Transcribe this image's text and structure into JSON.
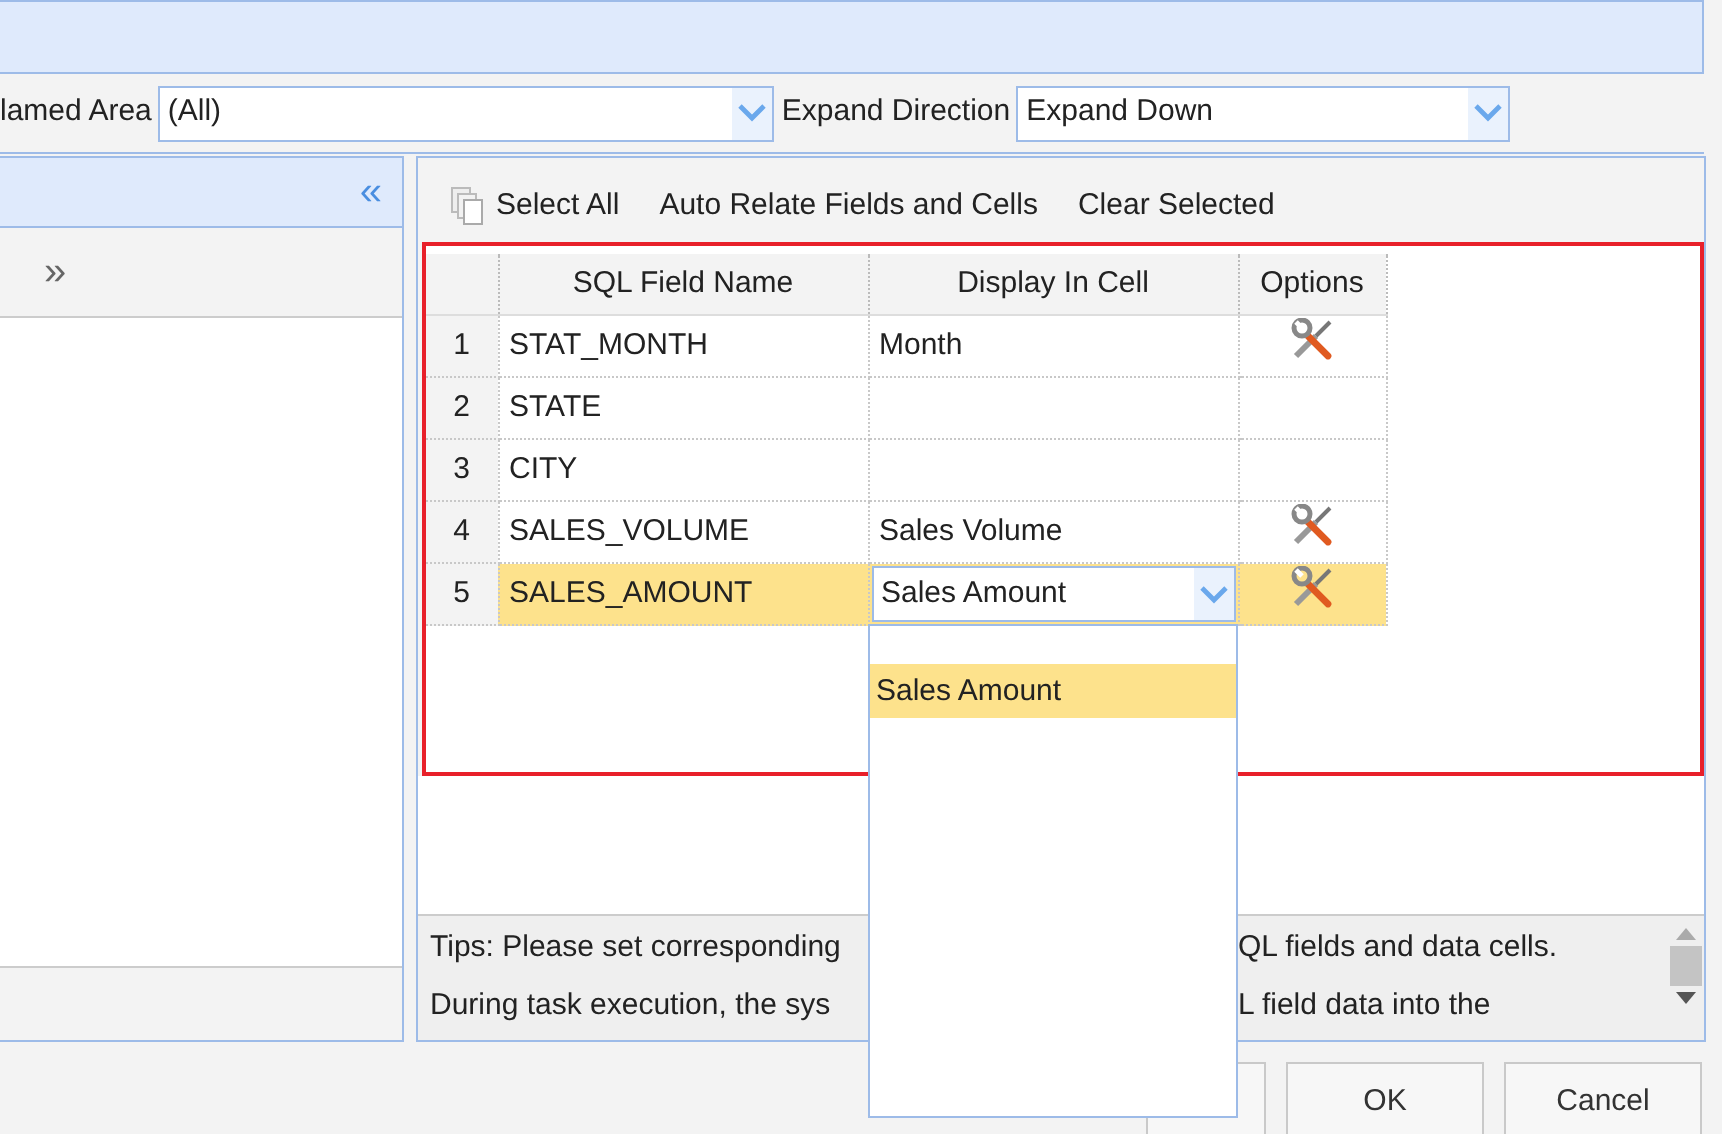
{
  "filters": [
    {
      "label": "lamed Area",
      "value": "(All)"
    },
    {
      "label": "Expand Direction",
      "value": "Expand Down"
    }
  ],
  "left_panel": {
    "collapse": "«",
    "expand": "»"
  },
  "toolbar": [
    {
      "kind": "icon",
      "label": "Select All"
    },
    {
      "kind": "text",
      "label": "Auto Relate Fields and Cells"
    },
    {
      "kind": "text",
      "label": "Clear Selected"
    }
  ],
  "grid": {
    "columns": [
      "SQL Field Name",
      "Display In Cell",
      "Options"
    ],
    "rows": [
      {
        "index": "1",
        "field": "STAT_MONTH",
        "display": "Month",
        "has_options": true,
        "selected": false,
        "editing": false
      },
      {
        "index": "2",
        "field": "STATE",
        "has_options": false,
        "selected": false,
        "editing": false
      },
      {
        "index": "3",
        "field": "CITY",
        "has_options": false,
        "selected": false,
        "editing": false
      },
      {
        "index": "4",
        "field": "SALES_VOLUME",
        "display": "Sales Volume",
        "has_options": true,
        "selected": false,
        "editing": false
      },
      {
        "index": "5",
        "field": "SALES_AMOUNT",
        "display": "Sales Amount",
        "has_options": true,
        "selected": true,
        "editing": true
      }
    ]
  },
  "dropdown": {
    "options": [
      {
        "label": "Sales Amount",
        "selected": true
      }
    ]
  },
  "tips": {
    "lines": [
      {
        "before": "Tips: Please set corresponding",
        "after": "QL fields and data cells."
      },
      {
        "before": "During task execution, the sys",
        "after": "L field data into the"
      }
    ]
  },
  "buttons": [
    "OK",
    "Cancel"
  ]
}
